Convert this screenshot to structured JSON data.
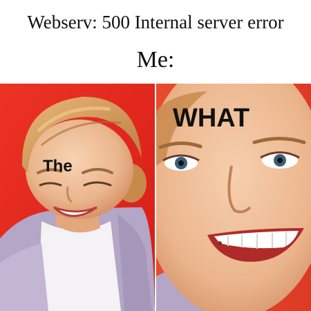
{
  "caption": {
    "line1": "Webserv: 500 Internal server error",
    "line2": "Me:"
  },
  "panels": {
    "left_label": "The",
    "right_label": "WHAT"
  },
  "colors": {
    "caption_background": "#ffffff",
    "left_panel_background": "#e0231d",
    "right_panel_background": "#e43c25",
    "cardigan": "#b4a8c8",
    "hair": "#d49a5a",
    "skin": "#efc09a"
  }
}
